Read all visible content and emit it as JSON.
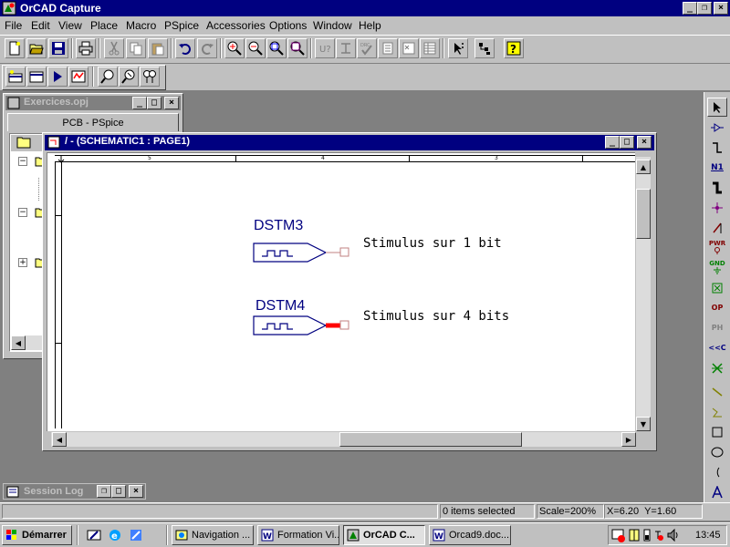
{
  "app": {
    "title": "OrCAD Capture"
  },
  "menu": [
    "File",
    "Edit",
    "View",
    "Place",
    "Macro",
    "PSpice",
    "Accessories",
    "Options",
    "Window",
    "Help"
  ],
  "project_window": {
    "title": "Exercices.opj",
    "tab_label": "PCB - PSpice"
  },
  "schematic_window": {
    "title": "/ - (SCHEMATIC1 : PAGE1)",
    "ruler": [
      "5",
      "4",
      "3"
    ],
    "parts": [
      {
        "ref": "DSTM3",
        "note": "Stimulus sur 1 bit"
      },
      {
        "ref": "DSTM4",
        "note": "Stimulus sur 4 bits"
      }
    ]
  },
  "session_log": {
    "title": "Session Log"
  },
  "status_bar": {
    "selection": "0 items selected",
    "scale": "Scale=200%",
    "coords": "X=6.20  Y=1.60"
  },
  "taskbar": {
    "start_label": "Démarrer",
    "tasks": [
      "Navigation ...",
      "Formation Vi...",
      "OrCAD C...",
      "Orcad9.doc..."
    ],
    "clock": "13:45"
  },
  "palette": {
    "net_alias": "N1",
    "power": "PWR",
    "ground": "GND",
    "offpage": "OP",
    "hier_pin": "PH",
    "no_connect": "<<C"
  },
  "colors": {
    "titlebar_active": "#000080",
    "part_outline": "#000080",
    "pin_highlight": "#ff0000"
  }
}
